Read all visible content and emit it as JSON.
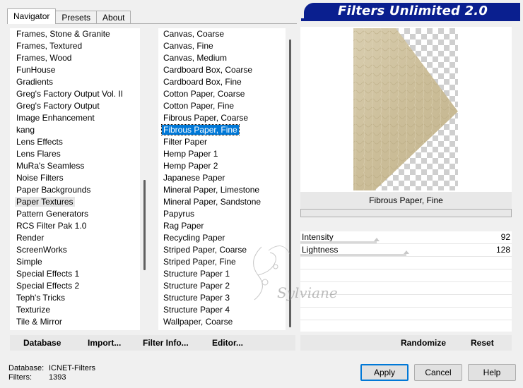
{
  "header": {
    "title": "Filters Unlimited 2.0"
  },
  "tabs": [
    {
      "label": "Navigator",
      "active": true
    },
    {
      "label": "Presets",
      "active": false
    },
    {
      "label": "About",
      "active": false
    }
  ],
  "categories": {
    "items": [
      "Frames, Stone & Granite",
      "Frames, Textured",
      "Frames, Wood",
      "FunHouse",
      "Gradients",
      "Greg's Factory Output Vol. II",
      "Greg's Factory Output",
      "Image Enhancement",
      "kang",
      "Lens Effects",
      "Lens Flares",
      "MuRa's Seamless",
      "Noise Filters",
      "Paper Backgrounds",
      "Paper Textures",
      "Pattern Generators",
      "RCS Filter Pak 1.0",
      "Render",
      "ScreenWorks",
      "Simple",
      "Special Effects 1",
      "Special Effects 2",
      "Teph's Tricks",
      "Texturize",
      "Tile & Mirror"
    ],
    "highlighted": "Paper Textures"
  },
  "filters": {
    "items": [
      "Canvas, Coarse",
      "Canvas, Fine",
      "Canvas, Medium",
      "Cardboard Box, Coarse",
      "Cardboard Box, Fine",
      "Cotton Paper, Coarse",
      "Cotton Paper, Fine",
      "Fibrous Paper, Coarse",
      "Fibrous Paper, Fine",
      "Filter Paper",
      "Hemp Paper 1",
      "Hemp Paper 2",
      "Japanese Paper",
      "Mineral Paper, Limestone",
      "Mineral Paper, Sandstone",
      "Papyrus",
      "Rag Paper",
      "Recycling Paper",
      "Striped Paper, Coarse",
      "Striped Paper, Fine",
      "Structure Paper 1",
      "Structure Paper 2",
      "Structure Paper 3",
      "Structure Paper 4",
      "Wallpaper, Coarse"
    ],
    "selected": "Fibrous Paper, Fine"
  },
  "preview": {
    "label": "Fibrous Paper, Fine"
  },
  "sliders": [
    {
      "label": "Intensity",
      "value": 92,
      "max": 255
    },
    {
      "label": "Lightness",
      "value": 128,
      "max": 255
    }
  ],
  "toolbar": {
    "database": "Database",
    "import": "Import...",
    "filter_info": "Filter Info...",
    "editor": "Editor...",
    "randomize": "Randomize",
    "reset": "Reset"
  },
  "status": {
    "database_label": "Database:",
    "database_value": "ICNET-Filters",
    "filters_label": "Filters:",
    "filters_value": "1393"
  },
  "buttons": {
    "apply": "Apply",
    "cancel": "Cancel",
    "help": "Help"
  },
  "watermark": {
    "text": "Sylviane"
  },
  "colors": {
    "banner": "#0a1f8f",
    "selection": "#0078d7",
    "paper": "#cfc3a2"
  }
}
